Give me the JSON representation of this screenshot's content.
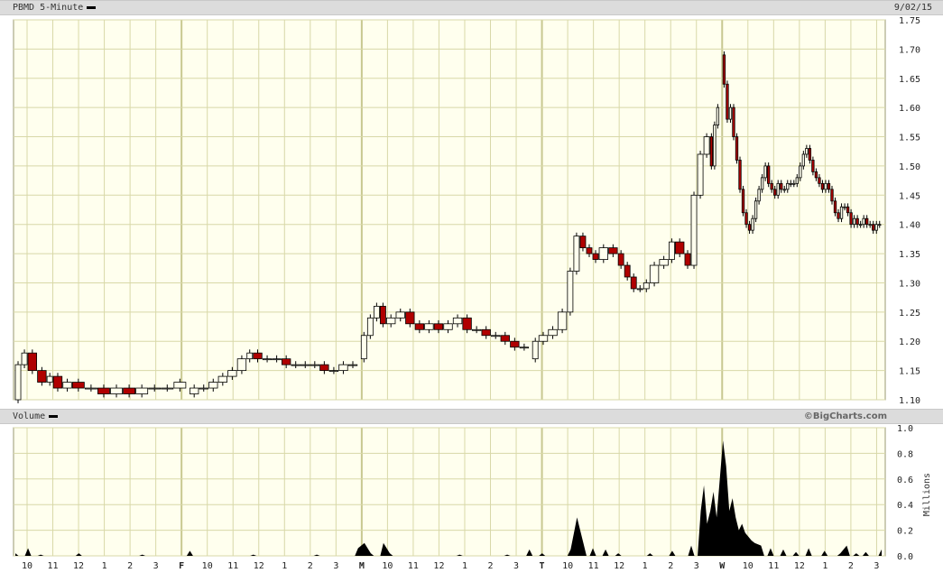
{
  "header": {
    "title": "PBMD 5-Minute",
    "date": "9/02/15"
  },
  "volume_header": {
    "title": "Volume",
    "credit": "©BigCharts.com"
  },
  "colors": {
    "background": "#ffffee",
    "grid": "#d8d8a8",
    "day_line": "#c8c890",
    "up": "#000000",
    "down": "#b00000",
    "volume": "#000000"
  },
  "chart_data": [
    {
      "type": "candlestick",
      "title": "PBMD 5-Minute",
      "ylim": [
        1.1,
        1.75
      ],
      "y_ticks": [
        "1.10",
        "1.15",
        "1.20",
        "1.25",
        "1.30",
        "1.35",
        "1.40",
        "1.45",
        "1.50",
        "1.55",
        "1.60",
        "1.65",
        "1.70",
        "1.75"
      ],
      "grid": true,
      "series": [
        {
          "segment": "day1",
          "points": [
            [
              0,
              1.1
            ],
            [
              2,
              1.16
            ],
            [
              4,
              1.18
            ],
            [
              7,
              1.15
            ],
            [
              10,
              1.13
            ],
            [
              12,
              1.14
            ],
            [
              15,
              1.12
            ],
            [
              18,
              1.13
            ],
            [
              22,
              1.12
            ],
            [
              26,
              1.12
            ],
            [
              30,
              1.11
            ],
            [
              34,
              1.12
            ],
            [
              38,
              1.11
            ],
            [
              42,
              1.12
            ],
            [
              46,
              1.12
            ],
            [
              50,
              1.12
            ],
            [
              54,
              1.13
            ]
          ]
        },
        {
          "segment": "day2",
          "points": [
            [
              55,
              1.11
            ],
            [
              58,
              1.12
            ],
            [
              61,
              1.12
            ],
            [
              64,
              1.13
            ],
            [
              67,
              1.14
            ],
            [
              70,
              1.15
            ],
            [
              73,
              1.17
            ],
            [
              75,
              1.18
            ],
            [
              78,
              1.17
            ],
            [
              81,
              1.17
            ],
            [
              84,
              1.17
            ],
            [
              87,
              1.16
            ],
            [
              90,
              1.16
            ],
            [
              93,
              1.16
            ],
            [
              96,
              1.16
            ],
            [
              99,
              1.15
            ],
            [
              102,
              1.15
            ],
            [
              105,
              1.16
            ],
            [
              108,
              1.16
            ]
          ]
        },
        {
          "segment": "day3",
          "points": [
            [
              109,
              1.17
            ],
            [
              111,
              1.21
            ],
            [
              113,
              1.24
            ],
            [
              115,
              1.26
            ],
            [
              117,
              1.23
            ],
            [
              120,
              1.24
            ],
            [
              123,
              1.25
            ],
            [
              126,
              1.23
            ],
            [
              129,
              1.22
            ],
            [
              132,
              1.23
            ],
            [
              135,
              1.22
            ],
            [
              138,
              1.23
            ],
            [
              141,
              1.24
            ],
            [
              144,
              1.22
            ],
            [
              147,
              1.22
            ],
            [
              150,
              1.21
            ],
            [
              153,
              1.21
            ],
            [
              156,
              1.2
            ],
            [
              159,
              1.19
            ],
            [
              162,
              1.19
            ]
          ]
        },
        {
          "segment": "day4",
          "points": [
            [
              163,
              1.17
            ],
            [
              165,
              1.2
            ],
            [
              168,
              1.21
            ],
            [
              171,
              1.22
            ],
            [
              174,
              1.25
            ],
            [
              176,
              1.32
            ],
            [
              178,
              1.38
            ],
            [
              180,
              1.36
            ],
            [
              182,
              1.35
            ],
            [
              184,
              1.34
            ],
            [
              187,
              1.36
            ],
            [
              190,
              1.35
            ],
            [
              192,
              1.33
            ],
            [
              194,
              1.31
            ],
            [
              196,
              1.29
            ],
            [
              198,
              1.29
            ],
            [
              200,
              1.3
            ],
            [
              203,
              1.33
            ],
            [
              206,
              1.34
            ],
            [
              208,
              1.37
            ],
            [
              211,
              1.35
            ],
            [
              213,
              1.33
            ],
            [
              215,
              1.45
            ],
            [
              217,
              1.52
            ],
            [
              219,
              1.55
            ],
            [
              220,
              1.5
            ],
            [
              221,
              1.57
            ],
            [
              222,
              1.6
            ]
          ]
        },
        {
          "segment": "day5",
          "points": [
            [
              223,
              1.69
            ],
            [
              224,
              1.64
            ],
            [
              225,
              1.58
            ],
            [
              226,
              1.6
            ],
            [
              227,
              1.55
            ],
            [
              228,
              1.51
            ],
            [
              229,
              1.46
            ],
            [
              230,
              1.42
            ],
            [
              231,
              1.4
            ],
            [
              232,
              1.39
            ],
            [
              233,
              1.41
            ],
            [
              234,
              1.44
            ],
            [
              235,
              1.46
            ],
            [
              236,
              1.48
            ],
            [
              237,
              1.5
            ],
            [
              238,
              1.47
            ],
            [
              239,
              1.46
            ],
            [
              240,
              1.45
            ],
            [
              241,
              1.47
            ],
            [
              242,
              1.46
            ],
            [
              243,
              1.46
            ],
            [
              244,
              1.47
            ],
            [
              245,
              1.47
            ],
            [
              246,
              1.47
            ],
            [
              247,
              1.48
            ],
            [
              248,
              1.5
            ],
            [
              249,
              1.52
            ],
            [
              250,
              1.53
            ],
            [
              251,
              1.51
            ],
            [
              252,
              1.49
            ],
            [
              253,
              1.48
            ],
            [
              254,
              1.47
            ],
            [
              255,
              1.46
            ],
            [
              256,
              1.47
            ],
            [
              257,
              1.46
            ],
            [
              258,
              1.44
            ],
            [
              259,
              1.42
            ],
            [
              260,
              1.41
            ],
            [
              261,
              1.43
            ],
            [
              262,
              1.43
            ],
            [
              263,
              1.42
            ],
            [
              264,
              1.4
            ],
            [
              265,
              1.41
            ],
            [
              266,
              1.4
            ],
            [
              267,
              1.4
            ],
            [
              268,
              1.41
            ],
            [
              269,
              1.4
            ],
            [
              270,
              1.4
            ],
            [
              271,
              1.39
            ],
            [
              272,
              1.4
            ],
            [
              273,
              1.4
            ]
          ]
        }
      ]
    },
    {
      "type": "area",
      "title": "Volume",
      "ylabel": "Millions",
      "ylim": [
        0,
        1.0
      ],
      "y_ticks": [
        "0.0",
        "0.2",
        "0.4",
        "0.6",
        "0.8",
        "1.0"
      ],
      "x_ticks": [
        {
          "label": "10",
          "day": false
        },
        {
          "label": "11",
          "day": false
        },
        {
          "label": "12",
          "day": false
        },
        {
          "label": "1",
          "day": false
        },
        {
          "label": "2",
          "day": false
        },
        {
          "label": "3",
          "day": false
        },
        {
          "label": "F",
          "day": true
        },
        {
          "label": "10",
          "day": false
        },
        {
          "label": "11",
          "day": false
        },
        {
          "label": "12",
          "day": false
        },
        {
          "label": "1",
          "day": false
        },
        {
          "label": "2",
          "day": false
        },
        {
          "label": "3",
          "day": false
        },
        {
          "label": "M",
          "day": true
        },
        {
          "label": "10",
          "day": false
        },
        {
          "label": "11",
          "day": false
        },
        {
          "label": "12",
          "day": false
        },
        {
          "label": "1",
          "day": false
        },
        {
          "label": "2",
          "day": false
        },
        {
          "label": "3",
          "day": false
        },
        {
          "label": "T",
          "day": true
        },
        {
          "label": "10",
          "day": false
        },
        {
          "label": "11",
          "day": false
        },
        {
          "label": "12",
          "day": false
        },
        {
          "label": "1",
          "day": false
        },
        {
          "label": "2",
          "day": false
        },
        {
          "label": "3",
          "day": false
        },
        {
          "label": "W",
          "day": true
        },
        {
          "label": "10",
          "day": false
        },
        {
          "label": "11",
          "day": false
        },
        {
          "label": "12",
          "day": false
        },
        {
          "label": "1",
          "day": false
        },
        {
          "label": "2",
          "day": false
        },
        {
          "label": "3",
          "day": false
        }
      ],
      "values": [
        [
          0,
          0.02
        ],
        [
          4,
          0.06
        ],
        [
          8,
          0.01
        ],
        [
          20,
          0.02
        ],
        [
          40,
          0.01
        ],
        [
          55,
          0.04
        ],
        [
          75,
          0.01
        ],
        [
          95,
          0.01
        ],
        [
          108,
          0.06
        ],
        [
          110,
          0.1
        ],
        [
          112,
          0.02
        ],
        [
          116,
          0.1
        ],
        [
          118,
          0.02
        ],
        [
          140,
          0.01
        ],
        [
          155,
          0.01
        ],
        [
          162,
          0.05
        ],
        [
          166,
          0.02
        ],
        [
          175,
          0.05
        ],
        [
          177,
          0.3
        ],
        [
          179,
          0.1
        ],
        [
          182,
          0.06
        ],
        [
          186,
          0.05
        ],
        [
          190,
          0.02
        ],
        [
          200,
          0.02
        ],
        [
          207,
          0.04
        ],
        [
          213,
          0.08
        ],
        [
          216,
          0.35
        ],
        [
          217,
          0.55
        ],
        [
          218,
          0.25
        ],
        [
          219,
          0.35
        ],
        [
          220,
          0.5
        ],
        [
          221,
          0.3
        ],
        [
          223,
          0.9
        ],
        [
          224,
          0.7
        ],
        [
          225,
          0.35
        ],
        [
          226,
          0.45
        ],
        [
          227,
          0.3
        ],
        [
          228,
          0.2
        ],
        [
          229,
          0.25
        ],
        [
          230,
          0.18
        ],
        [
          231,
          0.15
        ],
        [
          232,
          0.12
        ],
        [
          233,
          0.1
        ],
        [
          235,
          0.08
        ],
        [
          238,
          0.06
        ],
        [
          242,
          0.05
        ],
        [
          246,
          0.03
        ],
        [
          250,
          0.06
        ],
        [
          255,
          0.04
        ],
        [
          260,
          0.02
        ],
        [
          262,
          0.08
        ],
        [
          265,
          0.02
        ],
        [
          268,
          0.03
        ],
        [
          273,
          0.05
        ]
      ]
    }
  ]
}
